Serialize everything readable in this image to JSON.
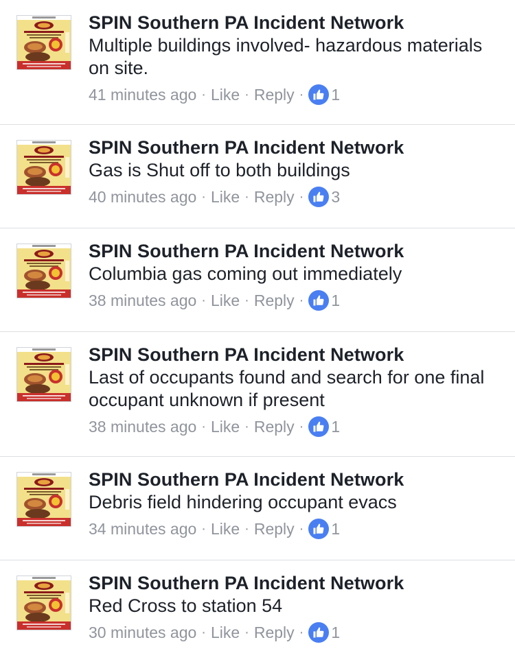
{
  "comments": [
    {
      "author": "SPIN Southern PA Incident Network",
      "text": "Multiple buildings involved- hazardous materials on site.",
      "time": "41 minutes ago",
      "like_label": "Like",
      "reply_label": "Reply",
      "reaction_count": "1"
    },
    {
      "author": "SPIN Southern PA Incident Network",
      "text": "Gas is Shut off to both buildings",
      "time": "40 minutes ago",
      "like_label": "Like",
      "reply_label": "Reply",
      "reaction_count": "3"
    },
    {
      "author": "SPIN Southern PA Incident Network",
      "text": "Columbia gas coming out immediately",
      "time": "38 minutes ago",
      "like_label": "Like",
      "reply_label": "Reply",
      "reaction_count": "1"
    },
    {
      "author": "SPIN Southern PA Incident Network",
      "text": "Last of occupants found and search for one final occupant unknown if present",
      "time": "38 minutes ago",
      "like_label": "Like",
      "reply_label": "Reply",
      "reaction_count": "1"
    },
    {
      "author": "SPIN Southern PA Incident Network",
      "text": "Debris field hindering occupant evacs",
      "time": "34 minutes ago",
      "like_label": "Like",
      "reply_label": "Reply",
      "reaction_count": "1"
    },
    {
      "author": "SPIN Southern PA Incident Network",
      "text": "Red Cross to station 54",
      "time": "30 minutes ago",
      "like_label": "Like",
      "reply_label": "Reply",
      "reaction_count": "1"
    }
  ],
  "avatar": {
    "icon": "fundraiser-flyer-avatar-icon",
    "colors": {
      "background": "#f3e08a",
      "banner": "#c9302c",
      "accent": "#8b1a1a",
      "food": "#a0522d"
    }
  },
  "reaction": {
    "icon": "thumbs-up-icon",
    "color": "#4a7ff2"
  }
}
